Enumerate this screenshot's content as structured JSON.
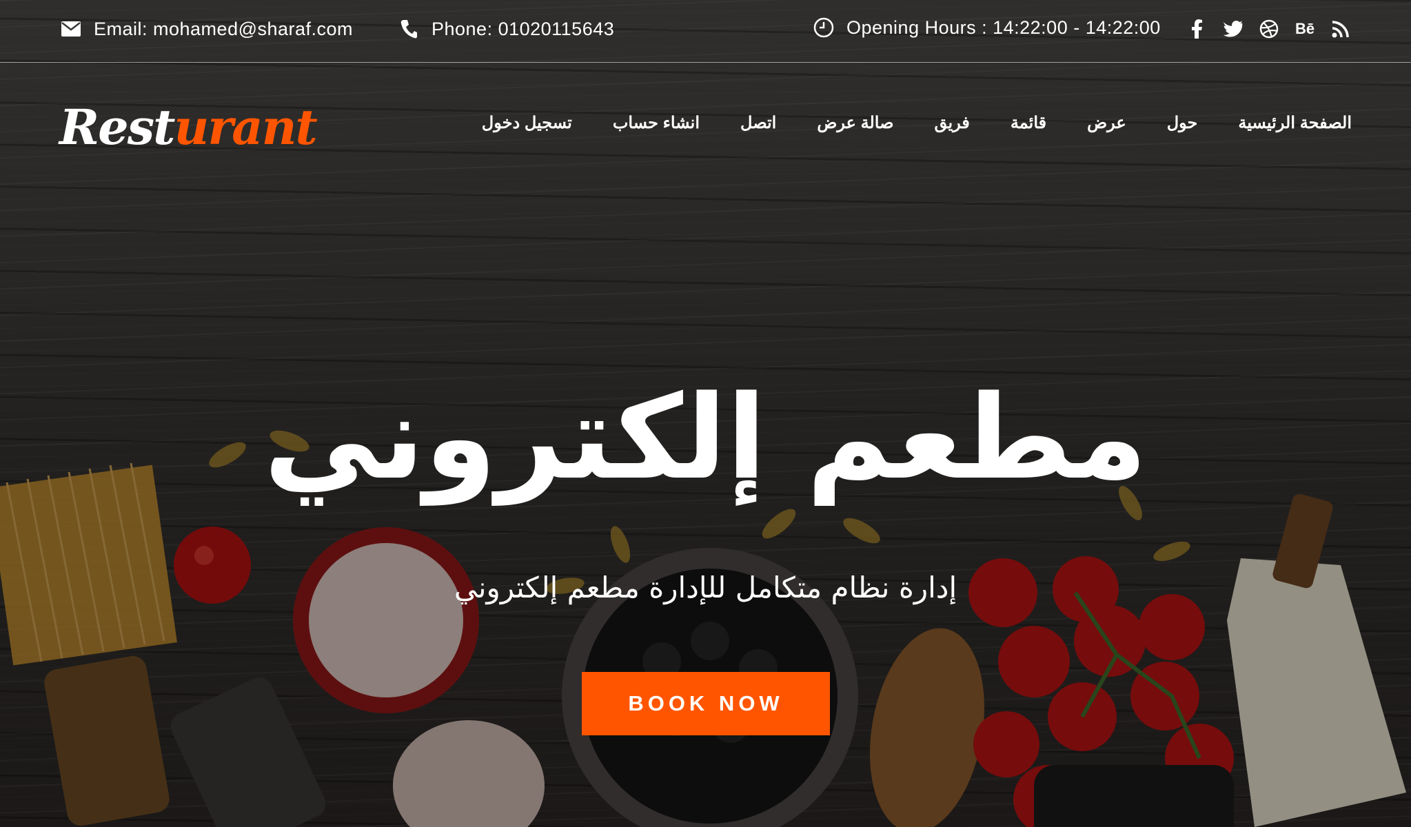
{
  "topbar": {
    "email": "Email: mohamed@sharaf.com",
    "phone": "Phone: 01020115643",
    "hours": "Opening Hours : 14:22:00 - 14:22:00",
    "social_icons": [
      "facebook-icon",
      "twitter-icon",
      "dribbble-icon",
      "behance-icon",
      "rss-icon"
    ],
    "behance_text": "Bē"
  },
  "logo": {
    "part1": "Rest",
    "part2": "urant"
  },
  "nav": {
    "items": [
      {
        "label": "تسجيل دخول"
      },
      {
        "label": "انشاء حساب"
      },
      {
        "label": "اتصل"
      },
      {
        "label": "صالة عرض"
      },
      {
        "label": "فريق"
      },
      {
        "label": "قائمة"
      },
      {
        "label": "عرض"
      },
      {
        "label": "حول"
      },
      {
        "label": "الصفحة الرئيسية"
      }
    ]
  },
  "hero": {
    "title": "مطعم إلكتروني",
    "subtitle": "إدارة نظام متكامل للإدارة مطعم إلكتروني",
    "button": "BOOK NOW"
  },
  "colors": {
    "accent": "#ff5500",
    "text": "#ffffff"
  }
}
